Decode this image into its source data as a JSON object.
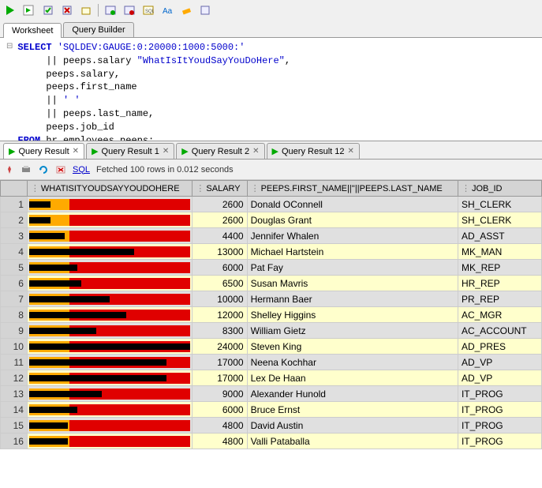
{
  "gauge": {
    "min": 0,
    "max": 20000,
    "yellow_start": 1000,
    "yellow_end": 5000
  },
  "toolbar": {
    "icons": [
      "run",
      "run-script",
      "commit",
      "rollback",
      "tuning",
      "explain",
      "autotrace",
      "sql",
      "search",
      "clear",
      "history"
    ]
  },
  "tabs": {
    "worksheet": "Worksheet",
    "query_builder": "Query Builder"
  },
  "sql": "SELECT 'SQLDEV:GAUGE:0:20000:1000:5000:'\n       || peeps.salary \"WhatIsItYoudSayYouDoHere\",\n       peeps.salary,\n       peeps.first_name\n       || ' '\n       || peeps.last_name,\n       peeps.job_id\nFROM hr.employees peeps;",
  "result_tabs": [
    {
      "label": "Query Result"
    },
    {
      "label": "Query Result 1"
    },
    {
      "label": "Query Result 2"
    },
    {
      "label": "Query Result 12"
    }
  ],
  "result_toolbar": {
    "sql_label": "SQL",
    "status": "Fetched 100 rows in 0.012 seconds"
  },
  "columns": [
    "",
    "WHATISITYOUDSAYYOUDOHERE",
    "SALARY",
    "PEEPS.FIRST_NAME||''||PEEPS.LAST_NAME",
    "JOB_ID"
  ],
  "rows": [
    {
      "n": 1,
      "salary": 2600,
      "name": "Donald OConnell",
      "job": "SH_CLERK"
    },
    {
      "n": 2,
      "salary": 2600,
      "name": "Douglas Grant",
      "job": "SH_CLERK"
    },
    {
      "n": 3,
      "salary": 4400,
      "name": "Jennifer Whalen",
      "job": "AD_ASST"
    },
    {
      "n": 4,
      "salary": 13000,
      "name": "Michael Hartstein",
      "job": "MK_MAN"
    },
    {
      "n": 5,
      "salary": 6000,
      "name": "Pat Fay",
      "job": "MK_REP"
    },
    {
      "n": 6,
      "salary": 6500,
      "name": "Susan Mavris",
      "job": "HR_REP"
    },
    {
      "n": 7,
      "salary": 10000,
      "name": "Hermann Baer",
      "job": "PR_REP"
    },
    {
      "n": 8,
      "salary": 12000,
      "name": "Shelley Higgins",
      "job": "AC_MGR"
    },
    {
      "n": 9,
      "salary": 8300,
      "name": "William Gietz",
      "job": "AC_ACCOUNT"
    },
    {
      "n": 10,
      "salary": 24000,
      "name": "Steven King",
      "job": "AD_PRES"
    },
    {
      "n": 11,
      "salary": 17000,
      "name": "Neena Kochhar",
      "job": "AD_VP"
    },
    {
      "n": 12,
      "salary": 17000,
      "name": "Lex De Haan",
      "job": "AD_VP"
    },
    {
      "n": 13,
      "salary": 9000,
      "name": "Alexander Hunold",
      "job": "IT_PROG"
    },
    {
      "n": 14,
      "salary": 6000,
      "name": "Bruce Ernst",
      "job": "IT_PROG"
    },
    {
      "n": 15,
      "salary": 4800,
      "name": "David Austin",
      "job": "IT_PROG"
    },
    {
      "n": 16,
      "salary": 4800,
      "name": "Valli Pataballa",
      "job": "IT_PROG"
    }
  ]
}
